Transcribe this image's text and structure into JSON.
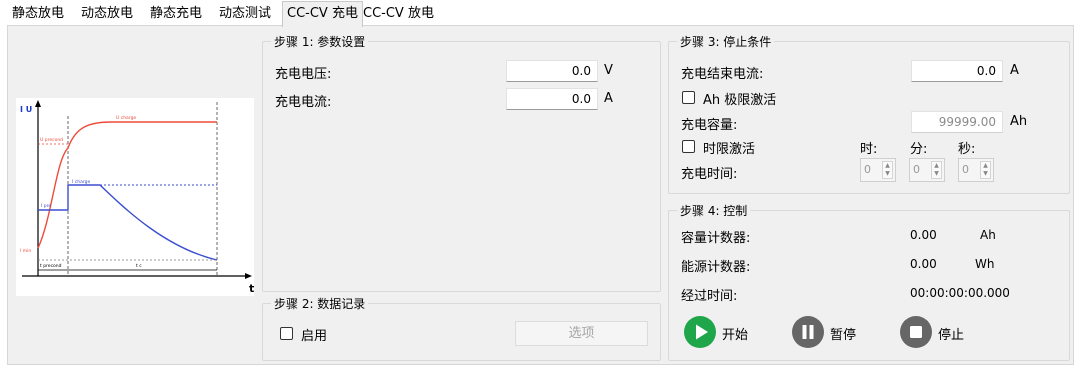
{
  "tabs": [
    {
      "label": "静态放电"
    },
    {
      "label": "动态放电"
    },
    {
      "label": "静态充电"
    },
    {
      "label": "动态测试"
    },
    {
      "label": "CC-CV 充电"
    },
    {
      "label": "CC-CV 放电"
    }
  ],
  "graph": {
    "y_label": "I U",
    "x_label": "t",
    "annotations": {
      "u_charge": "U charge",
      "u_precond": "U precond",
      "i_charge": "I charge",
      "i_pre": "I pre",
      "i_min": "I min",
      "t_precond": "t precond",
      "t_c": "t c"
    }
  },
  "step1": {
    "title": "步骤 1: 参数设置",
    "voltage": {
      "label": "充电电压:",
      "value": "0.0",
      "unit": "V"
    },
    "current": {
      "label": "充电电流:",
      "value": "0.0",
      "unit": "A"
    }
  },
  "step2": {
    "title": "步骤 2: 数据记录",
    "enable_label": "启用",
    "options_label": "选项"
  },
  "step3": {
    "title": "步骤 3: 停止条件",
    "end_current": {
      "label": "充电结束电流:",
      "value": "0.0",
      "unit": "A"
    },
    "ah_limit_label": "Ah 极限激活",
    "capacity": {
      "label": "充电容量:",
      "value": "99999.00",
      "unit": "Ah"
    },
    "time_limit_label": "时限激活",
    "time_headers": {
      "h": "时:",
      "m": "分:",
      "s": "秒:"
    },
    "charge_time_label": "充电时间:",
    "time_values": {
      "h": "0",
      "m": "0",
      "s": "0"
    }
  },
  "step4": {
    "title": "步骤 4: 控制",
    "capacity_counter": {
      "label": "容量计数器:",
      "value": "0.00",
      "unit": "Ah"
    },
    "energy_counter": {
      "label": "能源计数器:",
      "value": "0.00",
      "unit": "Wh"
    },
    "elapsed": {
      "label": "经过时间:",
      "value": "00:00:00:00.000"
    },
    "start_label": "开始",
    "pause_label": "暂停",
    "stop_label": "停止"
  },
  "colors": {
    "accent_green": "#1fa64a",
    "control_gray": "#666666",
    "voltage_curve": "#ee4b3a",
    "current_curve": "#3b4fcf"
  }
}
